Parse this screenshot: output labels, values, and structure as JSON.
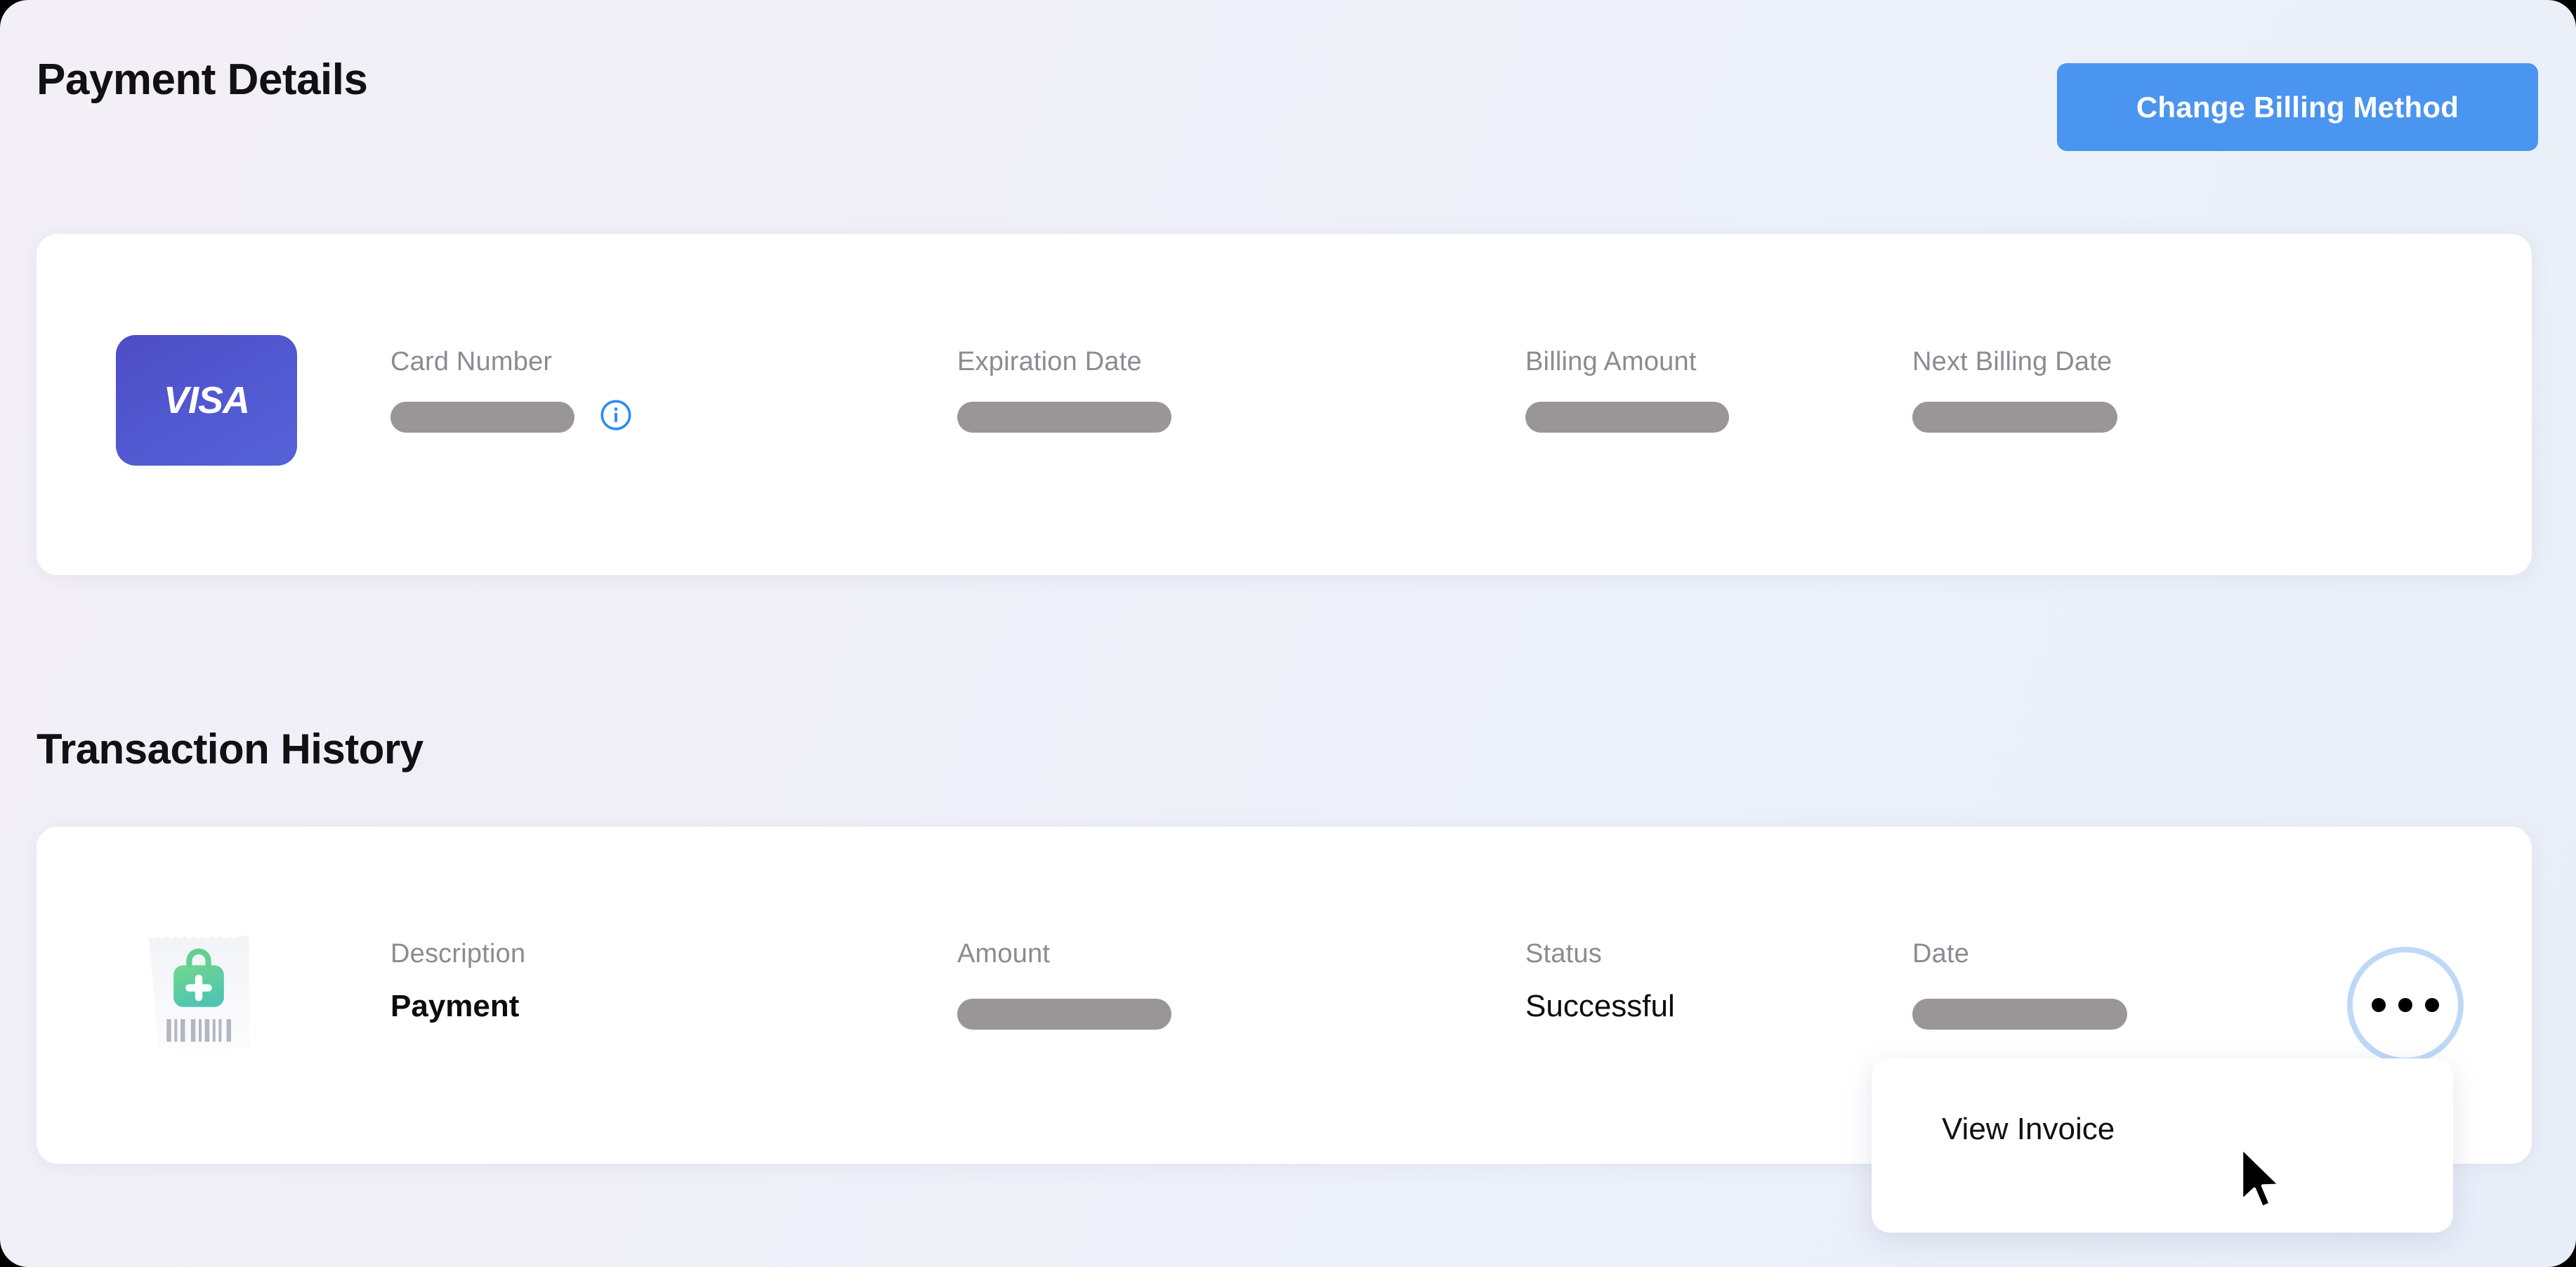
{
  "header": {
    "title": "Payment Details",
    "change_billing_button": "Change Billing Method"
  },
  "payment_details": {
    "card_brand": "VISA",
    "card_icon": "visa-card-icon",
    "fields": [
      {
        "label": "Card Number",
        "value": "",
        "redacted": true,
        "has_info_icon": true
      },
      {
        "label": "Expiration Date",
        "value": "",
        "redacted": true,
        "has_info_icon": false
      },
      {
        "label": "Billing Amount",
        "value": "",
        "redacted": true,
        "has_info_icon": false
      },
      {
        "label": "Next Billing Date",
        "value": "",
        "redacted": true,
        "has_info_icon": false
      }
    ]
  },
  "transaction_history": {
    "title": "Transaction History",
    "row_icon": "receipt-icon",
    "columns": [
      {
        "label": "Description",
        "value": "Payment",
        "redacted": false,
        "bold": true
      },
      {
        "label": "Amount",
        "value": "",
        "redacted": true,
        "bold": false
      },
      {
        "label": "Status",
        "value": "Successful",
        "redacted": false,
        "bold": false
      },
      {
        "label": "Date",
        "value": "",
        "redacted": true,
        "bold": false
      }
    ],
    "more_button_label": "•••"
  },
  "dropdown_menu": {
    "items": [
      {
        "label": "View Invoice"
      }
    ]
  },
  "colors": {
    "accent_blue": "#4a95ef",
    "info_blue": "#2f8bf5",
    "more_border_blue": "#bdd9f7",
    "redaction_gray": "#9a9698",
    "label_gray": "#8b8b92",
    "text_black": "#111113",
    "card_white": "#ffffff",
    "visa_purple": "#5157cf",
    "receipt_green": "#5fcf90"
  }
}
